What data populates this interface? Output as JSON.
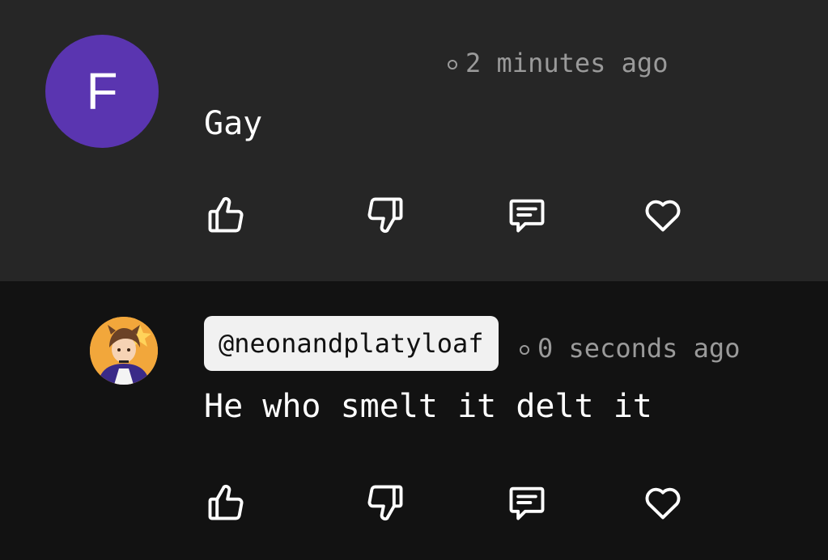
{
  "comments": [
    {
      "avatar_letter": "F",
      "avatar_color": "#5a35b0",
      "username": "",
      "timestamp": "2 minutes ago",
      "text": "Gay",
      "actions": [
        "thumbs-up-icon",
        "thumbs-down-icon",
        "reply-icon",
        "heart-icon"
      ]
    },
    {
      "avatar": "anime-character-avatar",
      "username": "@neonandplatyloaf",
      "timestamp": "0 seconds ago",
      "text": "He who smelt it delt it",
      "actions": [
        "thumbs-up-icon",
        "thumbs-down-icon",
        "reply-icon",
        "heart-icon"
      ]
    }
  ],
  "colors": {
    "card_bg_1": "#262626",
    "card_bg_2": "#121212",
    "meta_text": "#9a9a9a",
    "username_pill_bg": "#f1f1f1"
  }
}
